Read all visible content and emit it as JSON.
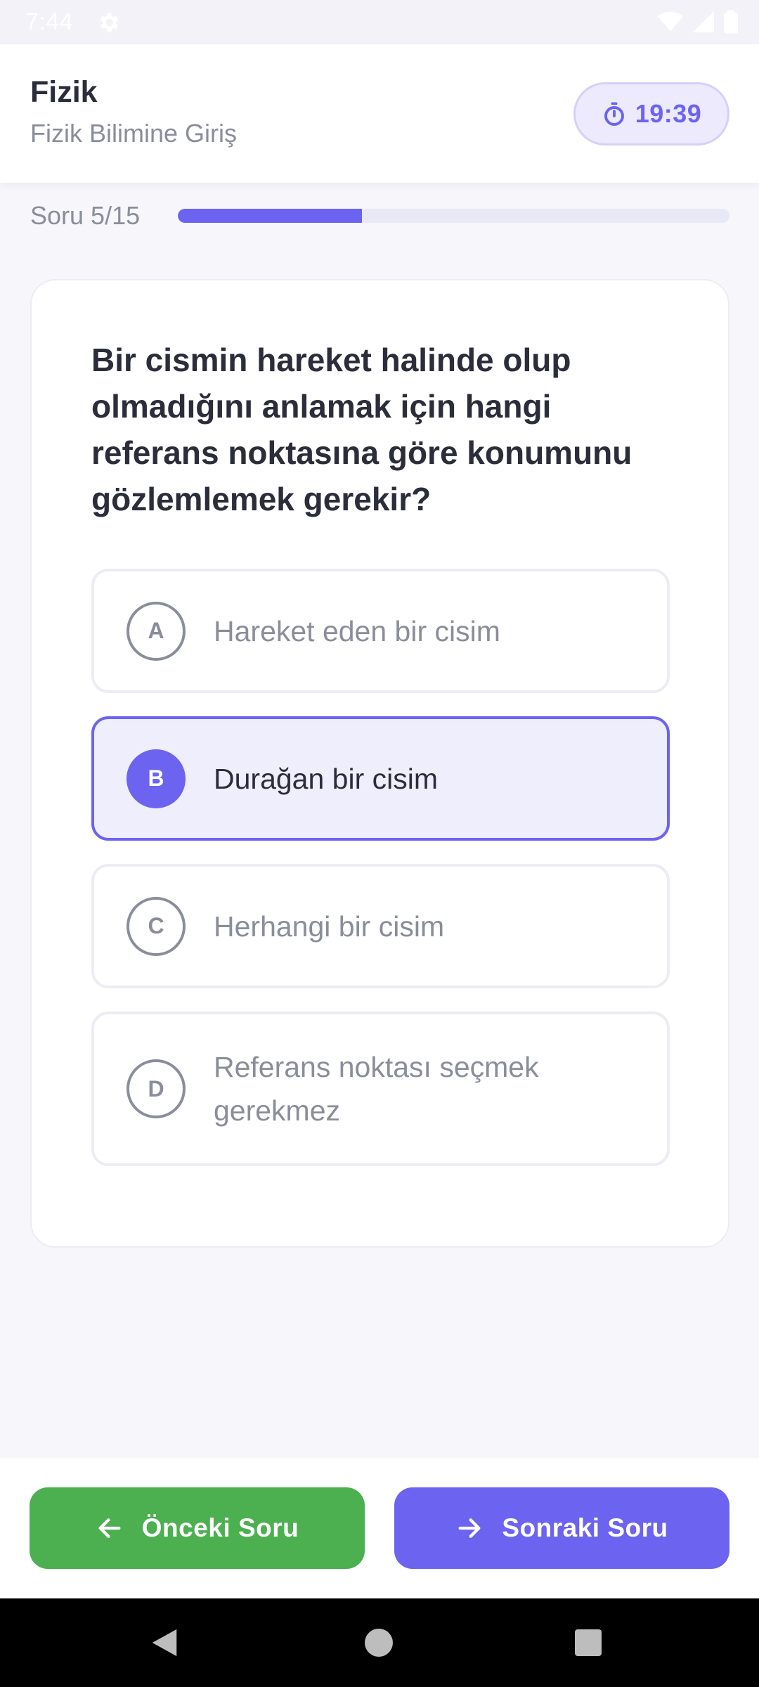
{
  "status_bar": {
    "time": "7:44"
  },
  "header": {
    "title": "Fizik",
    "subtitle": "Fizik Bilimine Giriş",
    "timer": "19:39",
    "timer_icon": "stopwatch-icon"
  },
  "progress": {
    "label": "Soru 5/15",
    "current": 5,
    "total": 15,
    "fraction": 0.3333
  },
  "question": {
    "text": "Bir cismin hareket halinde olup olmadığını anlamak için hangi referans noktasına göre konumunu gözlemlemek gerekir?"
  },
  "options": [
    {
      "letter": "A",
      "text": "Hareket eden bir cisim",
      "selected": false
    },
    {
      "letter": "B",
      "text": "Durağan bir cisim",
      "selected": true
    },
    {
      "letter": "C",
      "text": "Herhangi bir cisim",
      "selected": false
    },
    {
      "letter": "D",
      "text": "Referans noktası seçmek gerekmez",
      "selected": false
    }
  ],
  "navigation": {
    "prev_label": "Önceki Soru",
    "next_label": "Sonraki Soru",
    "prev_icon": "arrow-left-icon",
    "next_icon": "arrow-right-icon"
  },
  "colors": {
    "accent": "#6C63F0",
    "accent_light": "#EFEEFD",
    "success": "#4CAF50",
    "text_dark": "#2B2D3A",
    "text_muted": "#8A8D9A",
    "background": "#F6F6FB"
  }
}
